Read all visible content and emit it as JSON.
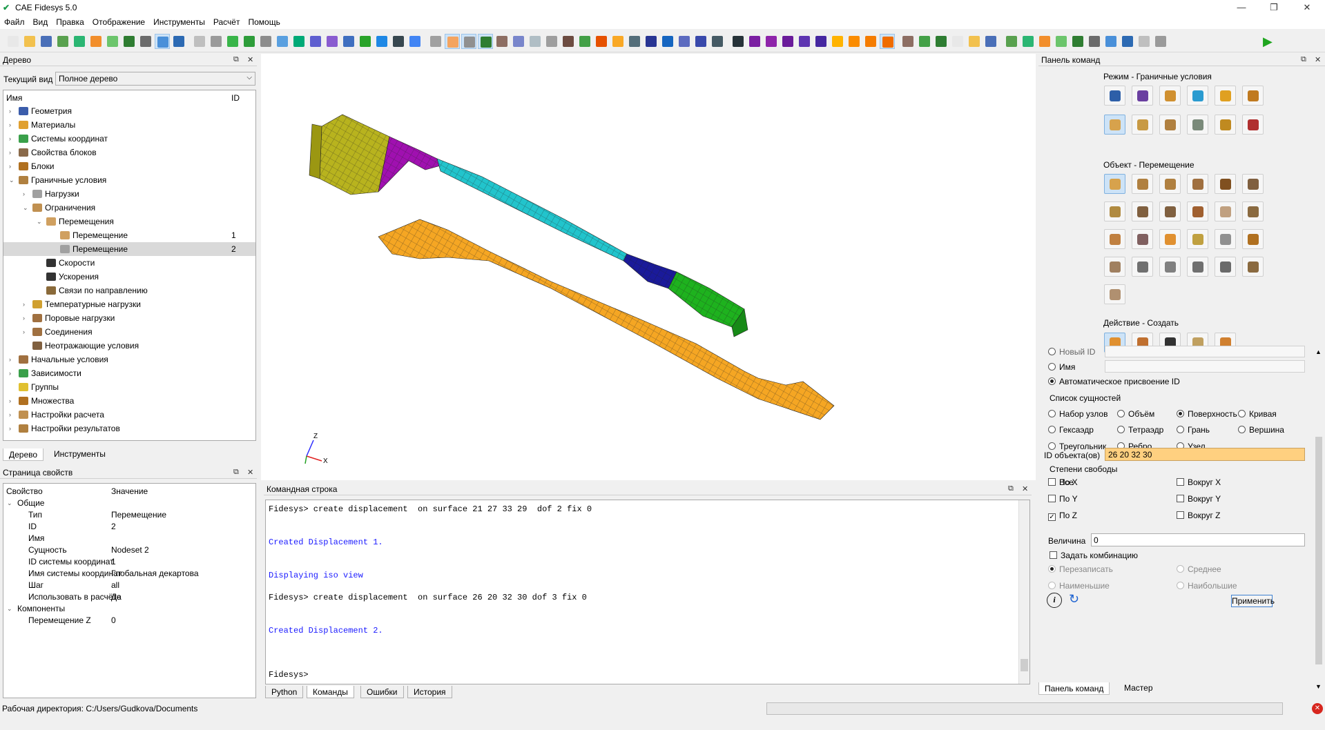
{
  "app": {
    "title": "CAE Fidesys 5.0",
    "workdir": "Рабочая директория: C:/Users/Gudkova/Documents"
  },
  "menu": [
    "Файл",
    "Вид",
    "Правка",
    "Отображение",
    "Инструменты",
    "Расчёт",
    "Помощь"
  ],
  "tree_panel": {
    "title": "Дерево",
    "view_label": "Текущий вид",
    "view_value": "Полное дерево",
    "col_name": "Имя",
    "col_id": "ID",
    "items": [
      {
        "label": "Геометрия",
        "id": ""
      },
      {
        "label": "Материалы",
        "id": ""
      },
      {
        "label": "Системы координат",
        "id": ""
      },
      {
        "label": "Свойства блоков",
        "id": ""
      },
      {
        "label": "Блоки",
        "id": ""
      },
      {
        "label": "Граничные условия",
        "id": ""
      },
      {
        "label": "Нагрузки",
        "id": ""
      },
      {
        "label": "Ограничения",
        "id": ""
      },
      {
        "label": "Перемещения",
        "id": ""
      },
      {
        "label": "Перемещение",
        "id": "1"
      },
      {
        "label": "Перемещение",
        "id": "2"
      },
      {
        "label": "Скорости",
        "id": ""
      },
      {
        "label": "Ускорения",
        "id": ""
      },
      {
        "label": "Связи по направлению",
        "id": ""
      },
      {
        "label": "Температурные нагрузки",
        "id": ""
      },
      {
        "label": "Поровые нагрузки",
        "id": ""
      },
      {
        "label": "Соединения",
        "id": ""
      },
      {
        "label": "Неотражающие условия",
        "id": ""
      },
      {
        "label": "Начальные условия",
        "id": ""
      },
      {
        "label": "Зависимости",
        "id": ""
      },
      {
        "label": "Группы",
        "id": ""
      },
      {
        "label": "Множества",
        "id": ""
      },
      {
        "label": "Настройки расчета",
        "id": ""
      },
      {
        "label": "Настройки результатов",
        "id": ""
      }
    ],
    "tabs": [
      "Дерево",
      "Инструменты"
    ]
  },
  "props_panel": {
    "title": "Страница свойств",
    "col_prop": "Свойство",
    "col_val": "Значение",
    "group1": "Общие",
    "rows": [
      {
        "k": "Тип",
        "v": "Перемещение"
      },
      {
        "k": "ID",
        "v": "2"
      },
      {
        "k": "Имя",
        "v": ""
      },
      {
        "k": "Сущность",
        "v": "Nodeset 2"
      },
      {
        "k": "ID системы координат",
        "v": "1"
      },
      {
        "k": "Имя системы координат",
        "v": "Глобальная декартова"
      },
      {
        "k": "Шаг",
        "v": "all"
      },
      {
        "k": "Использовать в расчёте",
        "v": "Да"
      }
    ],
    "group2": "Компоненты",
    "rows2": [
      {
        "k": "Перемещение Z",
        "v": "0"
      }
    ]
  },
  "axes": {
    "z": "Z",
    "x": "X"
  },
  "cmd_panel": {
    "title": "Командная строка",
    "lines": [
      {
        "t": "Fidesys> create displacement  on surface 21 27 33 29  dof 2 fix 0",
        "c": "k"
      },
      {
        "t": "Created Displacement 1.",
        "c": "b"
      },
      {
        "t": "Displaying iso view",
        "c": "b"
      },
      {
        "t": "Fidesys> create displacement  on surface 26 20 32 30 dof 3 fix 0",
        "c": "k"
      },
      {
        "t": "Created Displacement 2.",
        "c": "b"
      },
      {
        "t": "Fidesys>",
        "c": "k"
      }
    ],
    "tabs": [
      "Python",
      "Команды",
      "Ошибки",
      "История"
    ]
  },
  "right_panel": {
    "title": "Панель команд",
    "mode_title": "Режим - Граничные условия",
    "object_title": "Объект - Перемещение",
    "action_title": "Действие - Создать",
    "new_id": "Новый ID",
    "name": "Имя",
    "auto_id": "Автоматическое присвоение ID",
    "entity_list": "Список сущностей",
    "entities": [
      "Набор узлов",
      "Объём",
      "Поверхность",
      "Кривая",
      "Гексаэдр",
      "Тетраэдр",
      "Грань",
      "Вершина",
      "Треугольник",
      "Ребро",
      "Узел"
    ],
    "object_ids_label": "ID объекта(ов)",
    "object_ids_value": "26 20 32 30",
    "dof_title": "Степени свободы",
    "all": "Все",
    "dof": [
      "По X",
      "Вокруг X",
      "По Y",
      "Вокруг Y",
      "По Z",
      "Вокруг Z"
    ],
    "value_label": "Величина",
    "value": "0",
    "combo_label": "Задать комбинацию",
    "combo_opts": [
      "Перезаписать",
      "Среднее",
      "Наименьшие",
      "Наибольшие"
    ],
    "apply": "Применить",
    "tabs": [
      "Панель команд",
      "Мастер"
    ]
  },
  "colors": {
    "accent": "#cde3f7",
    "idfield": "#ffd080",
    "mesh_yellow": "#b8b31e",
    "mesh_orange": "#f5a623",
    "mesh_cyan": "#22c4cc",
    "mesh_magenta": "#a010b0",
    "mesh_blue": "#1a1a9a",
    "mesh_green": "#1eb21e"
  }
}
